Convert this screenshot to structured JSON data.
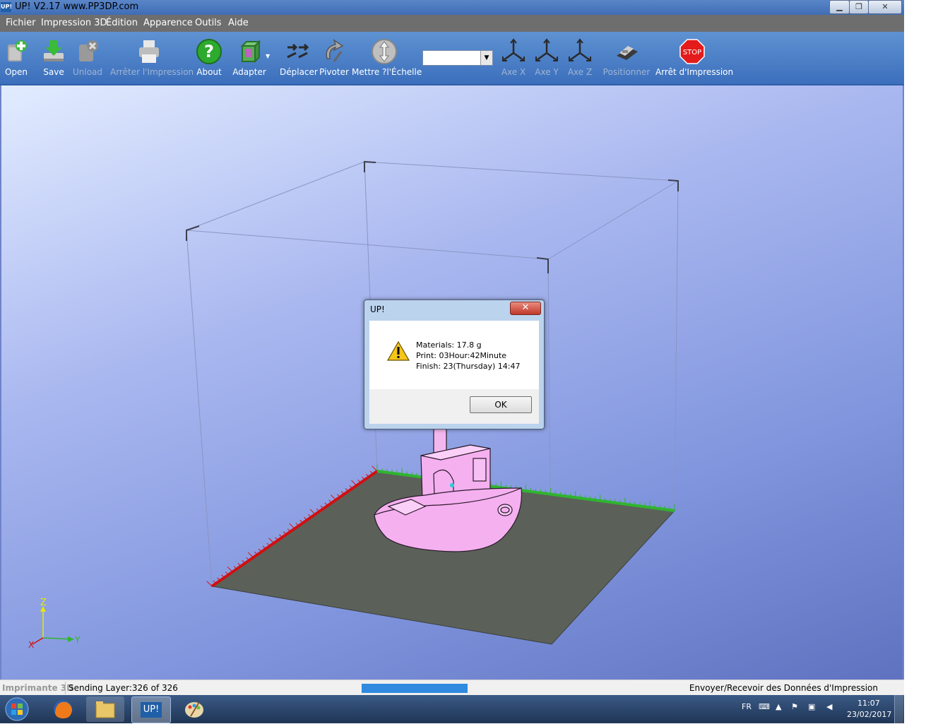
{
  "window": {
    "title": "UP!  V2.17 www.PP3DP.com",
    "app_icon_text": "UP!"
  },
  "menu": [
    "Fichier",
    "Impression 3D",
    "Édition",
    "Apparence",
    "Outils",
    "Aide"
  ],
  "toolbar": {
    "open": "Open",
    "save": "Save",
    "unload": "Unload",
    "stop_print": "Arrêter l'Impression",
    "about": "About",
    "adapt": "Adapter",
    "move": "Déplacer",
    "rotate": "Pivoter",
    "scale": "Mettre ?l'Échelle",
    "combo_value": "",
    "axis_x": "Axe X",
    "axis_y": "Axe Y",
    "axis_z": "Axe Z",
    "position": "Positionner",
    "stop_sign": "STOP",
    "halt": "Arrêt d'Impression"
  },
  "dialog": {
    "title": "UP!",
    "close": "✕",
    "line1": "Materials: 17.8 g",
    "line2": "Print: 03Hour:42Minute",
    "line3": "Finish: 23(Thursday) 14:47",
    "ok": "OK"
  },
  "axes_widget": {
    "z": "Z",
    "y": "Y",
    "x": "X"
  },
  "status": {
    "printer": "Imprimante 3D",
    "layer": "Sending Layer:326 of 326",
    "progress": 1.0,
    "transfer": "Envoyer/Recevoir des Données d'Impression"
  },
  "taskbar": {
    "up_label": "UP!",
    "lang": "FR",
    "time": "11:07",
    "date": "23/02/2017"
  },
  "colors": {
    "model": "#f5b0f0",
    "platform": "#5b6159",
    "x_ruler": "#d01010",
    "y_ruler": "#2fb52f",
    "progress": "#2f8ae0"
  }
}
